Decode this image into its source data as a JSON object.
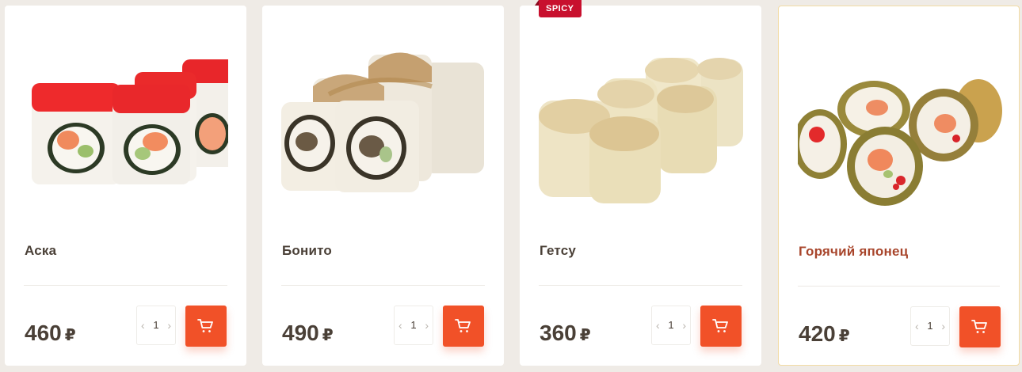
{
  "currency_symbol": "₽",
  "products": [
    {
      "name": "Аска",
      "price": "460",
      "quantity": "1",
      "badge": "",
      "image_icon": "sushi-roll-red-tobiko-icon"
    },
    {
      "name": "Бонито",
      "price": "490",
      "quantity": "1",
      "badge": "",
      "image_icon": "sushi-roll-bonito-icon"
    },
    {
      "name": "Гетсу",
      "price": "360",
      "quantity": "1",
      "badge": "SPICY",
      "image_icon": "sushi-roll-tempura-icon"
    },
    {
      "name": "Горячий японец",
      "price": "420",
      "quantity": "1",
      "badge": "",
      "image_icon": "sushi-roll-hot-tempura-icon"
    }
  ],
  "colors": {
    "accent": "#f15128",
    "badge": "#c8102e",
    "active_border": "#f2dba4",
    "active_name": "#a8452b",
    "text": "#4a4037",
    "background": "#efebe6"
  },
  "icons": {
    "cart": "shopping-cart-icon",
    "minus": "chevron-left-icon",
    "plus": "chevron-right-icon"
  }
}
